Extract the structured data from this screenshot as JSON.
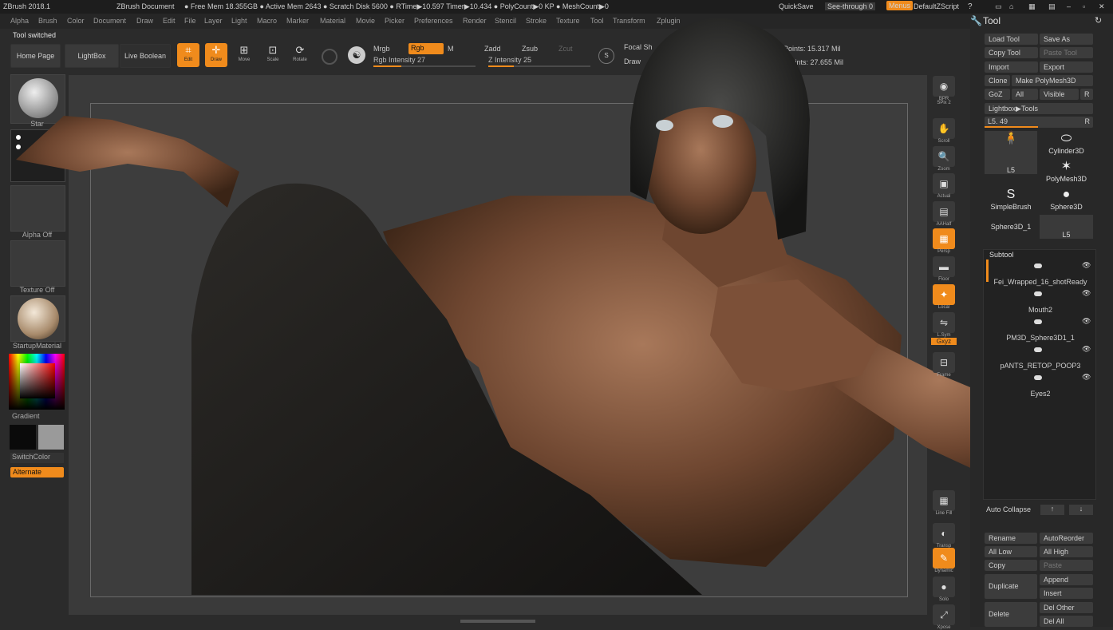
{
  "titlebar": {
    "app": "ZBrush 2018.1",
    "document": "ZBrush Document",
    "stats": "● Free Mem 18.355GB ● Active Mem 2643 ● Scratch Disk 5600 ● RTime▶10.597 Timer▶10.434 ● PolyCount▶0 KP ● MeshCount▶0",
    "quicksave": "QuickSave",
    "seethrough": "See-through  0",
    "menus": "Menus",
    "script": "DefaultZScript"
  },
  "menubar": [
    "Alpha",
    "Brush",
    "Color",
    "Document",
    "Draw",
    "Edit",
    "File",
    "Layer",
    "Light",
    "Macro",
    "Marker",
    "Material",
    "Movie",
    "Picker",
    "Preferences",
    "Render",
    "Stencil",
    "Stroke",
    "Texture",
    "Tool",
    "Transform",
    "Zplugin"
  ],
  "status": "Tool switched",
  "shelf": {
    "home": "Home Page",
    "lightbox": "LightBox",
    "liveboolean": "Live Boolean",
    "modes": [
      {
        "label": "Edit",
        "icon": "edit-icon",
        "glyph": "⌗",
        "on": true
      },
      {
        "label": "Draw",
        "icon": "draw-icon",
        "glyph": "✛",
        "on": true
      },
      {
        "label": "Move",
        "icon": "move-icon",
        "glyph": "⊞",
        "on": false
      },
      {
        "label": "Scale",
        "icon": "scale-icon",
        "glyph": "⊡",
        "on": false
      },
      {
        "label": "Rotate",
        "icon": "rotate-icon",
        "glyph": "⟳",
        "on": false
      }
    ],
    "mrgb": "Mrgb",
    "rgb": "Rgb",
    "m": "M",
    "rgb_intensity": "Rgb Intensity 27",
    "rgb_intensity_value": 27,
    "zadd": "Zadd",
    "zsub": "Zsub",
    "zcut": "Zcut",
    "z_intensity": "Z Intensity 25",
    "z_intensity_value": 25,
    "focal": "Focal Sh",
    "draw_size": "Draw",
    "active_points": "Points: 15.317 Mil",
    "total_points": "al Points: 27.655 Mil"
  },
  "leftshelf": {
    "brush": "Star",
    "alpha": "Alpha Off",
    "texture": "Texture Off",
    "material": "StartupMaterial",
    "gradient": "Gradient",
    "switchcolor": "SwitchColor",
    "alternate": "Alternate",
    "colors": {
      "main": "#0a0a0a",
      "secondary": "#9a9a9a"
    }
  },
  "rightshelf": [
    {
      "label": "BPR",
      "glyph": "◉",
      "on": false
    },
    {
      "label": "SPix 2",
      "glyph": "",
      "on": false
    },
    {
      "label": "Scroll",
      "glyph": "✋",
      "on": false
    },
    {
      "label": "Zoom",
      "glyph": "🔍",
      "on": false
    },
    {
      "label": "Actual",
      "glyph": "▣",
      "on": false
    },
    {
      "label": "AAHalf",
      "glyph": "▤",
      "on": false
    },
    {
      "label": "Persp",
      "glyph": "▦",
      "on": true
    },
    {
      "label": "Floor",
      "glyph": "▬",
      "on": false
    },
    {
      "label": "Local",
      "glyph": "✦",
      "on": true
    },
    {
      "label": "L.Sym",
      "glyph": "⇋",
      "on": false
    },
    {
      "label": "Gxyz",
      "glyph": "",
      "on": true
    },
    {
      "label": "Frame",
      "glyph": "⊟",
      "on": false
    },
    {
      "label": "Line Fill",
      "glyph": "▦",
      "on": false
    },
    {
      "label": "Transp",
      "glyph": "◐",
      "on": false
    },
    {
      "label": "Dynamic",
      "glyph": "✎",
      "on": true
    },
    {
      "label": "Solo",
      "glyph": "●",
      "on": false
    },
    {
      "label": "Xpose",
      "glyph": "⤢",
      "on": false
    }
  ],
  "tool": {
    "title": "Tool",
    "buttons": [
      [
        "Load Tool",
        "Save As"
      ],
      [
        "Copy Tool",
        "Paste Tool"
      ],
      [
        "Import",
        "Export"
      ],
      [
        "Clone",
        "Make PolyMesh3D"
      ],
      [
        "GoZ",
        "All",
        "Visible",
        "R"
      ],
      [
        "Lightbox▶Tools"
      ]
    ],
    "current": "L5. 49",
    "current_value": 49,
    "thumbs": [
      "L5",
      "Cylinder3D",
      "PolyMesh3D",
      "SimpleBrush",
      "Sphere3D",
      "Sphere3D_1",
      "L5"
    ],
    "subtool_title": "Subtool",
    "subtools": [
      "Fei_Wrapped_16_shotReady",
      "Mouth2",
      "PM3D_Sphere3D1_1",
      "pANTS_RETOP_POOP3",
      "Eyes2"
    ],
    "auto_collapse": "Auto Collapse",
    "bottom": [
      [
        "Rename",
        "AutoReorder"
      ],
      [
        "All Low",
        "All High"
      ],
      [
        "Copy",
        "Paste"
      ],
      [
        "Duplicate",
        "Append"
      ],
      [
        "",
        "Insert"
      ],
      [
        "Delete",
        "Del Other"
      ],
      [
        "",
        "Del All"
      ]
    ]
  }
}
